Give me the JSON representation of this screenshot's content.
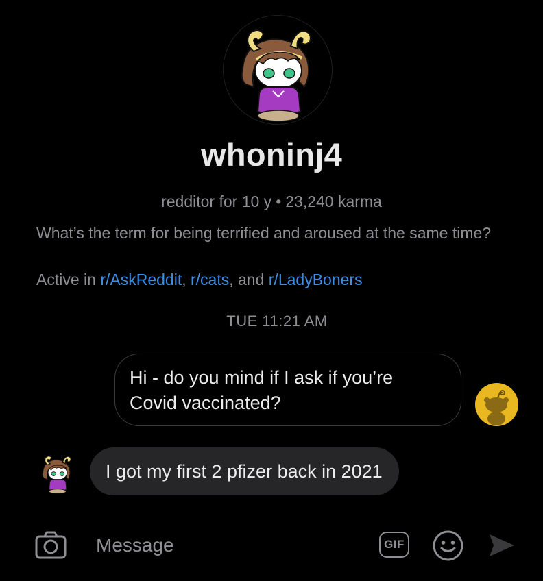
{
  "profile": {
    "username": "whoninj4",
    "tenure": "redditor for 10 y",
    "separator": "•",
    "karma": "23,240 karma",
    "bio": "What’s the term for being terrified and aroused at the same time?",
    "active_prefix": "Active in ",
    "active_subs": [
      "r/AskReddit",
      "r/cats",
      "r/LadyBoners"
    ],
    "active_sep1": ", ",
    "active_sep2": ", and "
  },
  "chat": {
    "timestamp": "TUE 11:21 AM",
    "messages": [
      {
        "direction": "outgoing",
        "text": "Hi - do you mind if I ask if you’re Covid vaccinated?"
      },
      {
        "direction": "incoming",
        "text": "I got my first 2 pfizer back in 2021"
      }
    ]
  },
  "composer": {
    "placeholder": "Message",
    "camera_icon": "camera-icon",
    "gif_label": "GIF",
    "emoji_icon": "smiley-icon",
    "send_icon": "send-icon"
  },
  "colors": {
    "background": "#000000",
    "link": "#3a8ee6",
    "muted": "#8e8e93",
    "incoming_bubble": "#262628",
    "outgoing_border": "#3a3a3c",
    "my_avatar": "#e9b820"
  }
}
